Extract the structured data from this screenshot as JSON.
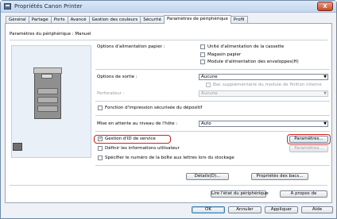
{
  "window": {
    "title": "Propriétés Canon Printer",
    "close_symbol": "X"
  },
  "tabs": [
    {
      "label": "Général",
      "active": false
    },
    {
      "label": "Partage",
      "active": false
    },
    {
      "label": "Ports",
      "active": false
    },
    {
      "label": "Avancé",
      "active": false
    },
    {
      "label": "Gestion des couleurs",
      "active": false
    },
    {
      "label": "Sécurité",
      "active": false
    },
    {
      "label": "Paramètres de périphérique",
      "active": true
    },
    {
      "label": "Profil",
      "active": false
    }
  ],
  "device": {
    "label": "Paramètres du périphérique : Manuel"
  },
  "paper_source": {
    "label": "Options d'alimentation papier :",
    "options": [
      {
        "label": "Unité d'alimentation de la cassette",
        "checked": false
      },
      {
        "label": "Magasin papier",
        "checked": false
      },
      {
        "label": "Module d'alimentation des enveloppes(H)",
        "checked": false
      }
    ]
  },
  "output": {
    "label": "Options de sortie :",
    "value": "Aucune",
    "extra_tray_label": "Bac supplémentaire du module de finition interne",
    "puncher_label": "Perforateur :",
    "puncher_value": "Aucune"
  },
  "secure_print": {
    "label": "Fonction d'impression sécurisée du dépositif"
  },
  "sleep": {
    "label": "Mise en attente au niveau de l'hôte :",
    "value": "Auto"
  },
  "dept_id": {
    "label": "Gestion d'ID de service",
    "checked": true,
    "settings_label": "Paramètres..."
  },
  "user_info": {
    "label": "Définir les informations utilisateur",
    "settings_label": "Paramètres..."
  },
  "mailbox": {
    "label": "Spécifier le numéro de la boîte aux lettres lors du stockage"
  },
  "buttons": {
    "details": "Détails(D)...",
    "mailbox_props": "Propriétés des bacs...",
    "read_device": "Lire l'état du périphérique",
    "about": "A propos de",
    "ok": "OK",
    "cancel": "Annuler",
    "apply": "Appliquer",
    "help": "Aide"
  }
}
